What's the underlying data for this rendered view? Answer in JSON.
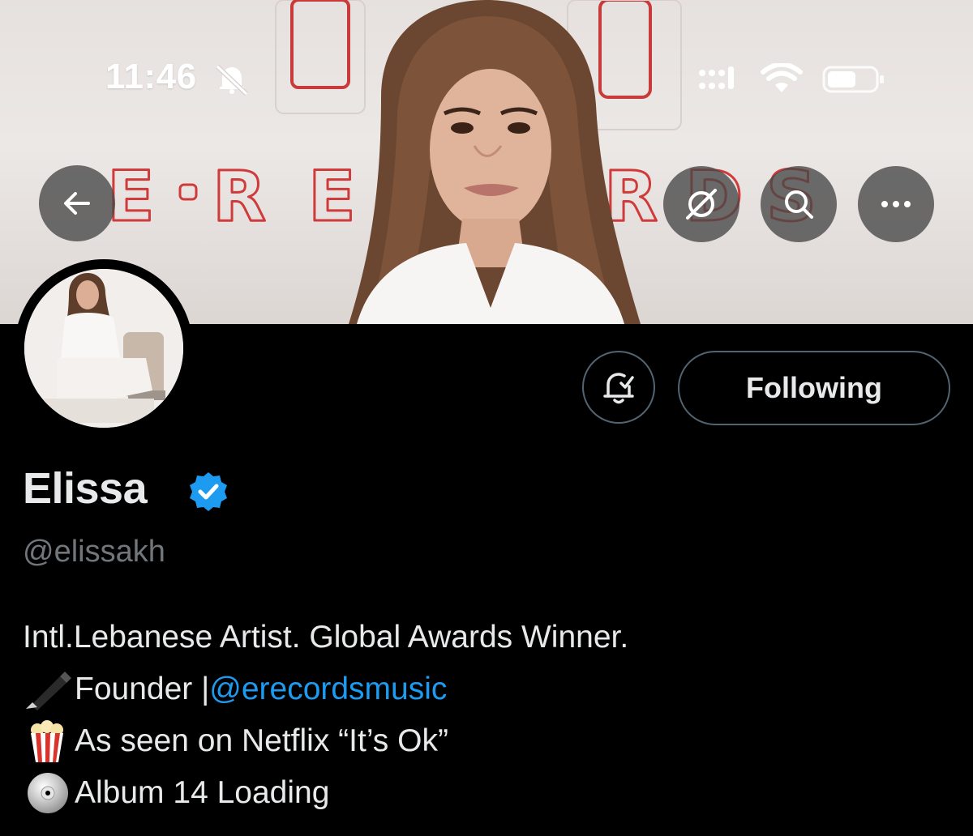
{
  "status_bar": {
    "time": "11:46"
  },
  "banner": {
    "brand_letters": [
      "E",
      "-",
      "R",
      "E",
      "R",
      "D",
      "S"
    ]
  },
  "nav": {
    "back_icon": "arrow-left-icon",
    "grok_icon": "grok-icon",
    "search_icon": "search-icon",
    "more_icon": "more-horizontal-icon"
  },
  "actions": {
    "notify_icon": "bell-check-icon",
    "follow_label": "Following"
  },
  "profile": {
    "name": "Elissa",
    "handle": "@elissakh",
    "verified_color": "#1d9bf0"
  },
  "bio": {
    "line1": "Intl.Lebanese Artist. Global Awards Winner.",
    "line2_text": "Founder | ",
    "line2_link": "@erecordsmusic",
    "line3": "As seen on Netflix “It’s Ok”",
    "line4": "Album 14 Loading"
  },
  "colors": {
    "accent": "#1d9bf0",
    "muted_text": "#71767b",
    "border": "#536471"
  }
}
